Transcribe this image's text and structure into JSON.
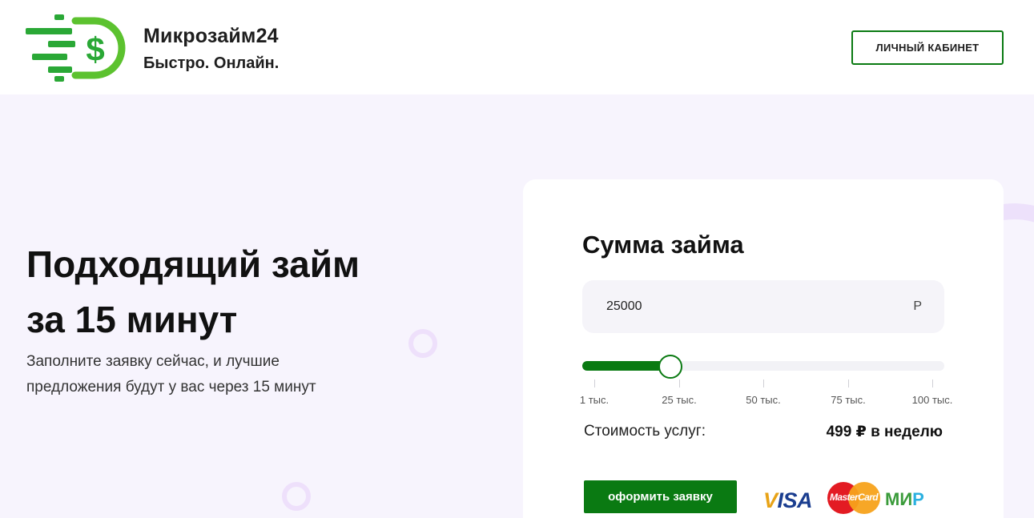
{
  "header": {
    "brand_name": "Микрозайм24",
    "tagline": "Быстро. Онлайн.",
    "cabinet_label": "ЛИЧНЫЙ КАБИНЕТ"
  },
  "hero": {
    "title_line1": "Подходящий займ",
    "title_line2": "за 15 минут",
    "subtitle_line1": "Заполните заявку сейчас, и лучшие",
    "subtitle_line2": "предложения будут у вас через 15 минут"
  },
  "calculator": {
    "title": "Сумма займа",
    "amount_value": "25000",
    "currency": "Р",
    "slider": {
      "min": 1000,
      "max": 100000,
      "value": 25000
    },
    "ticks": [
      "1 тыс.",
      "25 тыс.",
      "50 тыс.",
      "75 тыс.",
      "100 тыс."
    ],
    "cost_label": "Стоимость услуг:",
    "cost_value": "499 ₽ в неделю",
    "apply_label": "оформить заявку",
    "payment_logos": {
      "visa": "VISA",
      "mastercard": "MasterCard",
      "mir": "МИР"
    }
  },
  "colors": {
    "accent": "#0a7a12",
    "hero_bg": "#f7f4fd",
    "logo_green": "#2aa836"
  }
}
